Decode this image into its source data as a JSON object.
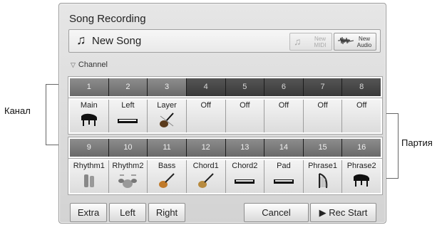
{
  "annotations": {
    "channel_label": "Канал",
    "part_label": "Партия"
  },
  "panel": {
    "title": "Song Recording",
    "song_name": "New Song",
    "new_midi": {
      "line1": "New",
      "line2": "MIDI",
      "icon": "music-note-icon"
    },
    "new_audio": {
      "line1": "New",
      "line2": "Audio",
      "icon": "waveform-icon"
    },
    "channel_label": "Channel"
  },
  "channels_top": [
    "1",
    "2",
    "3",
    "4",
    "5",
    "6",
    "7",
    "8"
  ],
  "channels_bottom": [
    "9",
    "10",
    "11",
    "12",
    "13",
    "14",
    "15",
    "16"
  ],
  "parts_top": [
    {
      "name": "Main",
      "icon": "grand-piano-icon"
    },
    {
      "name": "Left",
      "icon": "keyboard-icon"
    },
    {
      "name": "Layer",
      "icon": "violin-icon"
    },
    {
      "name": "Off"
    },
    {
      "name": "Off"
    },
    {
      "name": "Off"
    },
    {
      "name": "Off"
    },
    {
      "name": "Off"
    }
  ],
  "parts_bottom": [
    {
      "name": "Rhythm1",
      "icon": "bongo-icon"
    },
    {
      "name": "Rhythm2",
      "icon": "drum-kit-icon"
    },
    {
      "name": "Bass",
      "icon": "bass-guitar-icon"
    },
    {
      "name": "Chord1",
      "icon": "electric-guitar-icon"
    },
    {
      "name": "Chord2",
      "icon": "keyboard-icon"
    },
    {
      "name": "Pad",
      "icon": "keyboard-icon"
    },
    {
      "name": "Phrase1",
      "icon": "harp-icon"
    },
    {
      "name": "Phrase2",
      "icon": "grand-piano-icon"
    }
  ],
  "buttons": {
    "extra": "Extra",
    "left": "Left",
    "right": "Right",
    "cancel": "Cancel",
    "rec_start": "Rec Start"
  }
}
